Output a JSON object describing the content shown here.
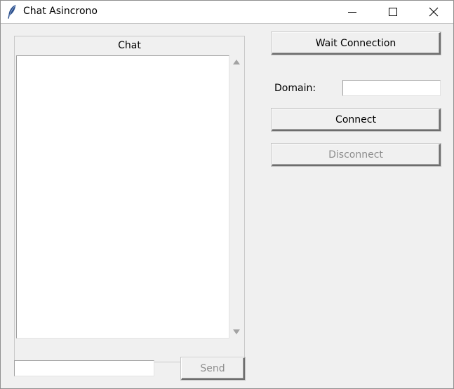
{
  "window": {
    "title": "Chat Asincrono",
    "app_icon": "feather-icon",
    "controls": {
      "minimize_icon": "minimize-icon",
      "maximize_icon": "maximize-icon",
      "close_icon": "close-icon"
    }
  },
  "chat": {
    "label": "Chat",
    "content": "",
    "scroll_up_icon": "arrow-up-icon",
    "scroll_down_icon": "arrow-down-icon"
  },
  "message": {
    "value": "",
    "placeholder": "",
    "send_label": "Send",
    "send_enabled": false
  },
  "connection": {
    "wait_label": "Wait Connection",
    "domain_label": "Domain:",
    "domain_value": "",
    "connect_label": "Connect",
    "disconnect_label": "Disconnect",
    "disconnect_enabled": false
  },
  "colors": {
    "window_bg": "#f0f0f0",
    "titlebar_bg": "#ffffff",
    "disabled_text": "#8d8d8d",
    "icon_blue": "#2b4f8c"
  }
}
